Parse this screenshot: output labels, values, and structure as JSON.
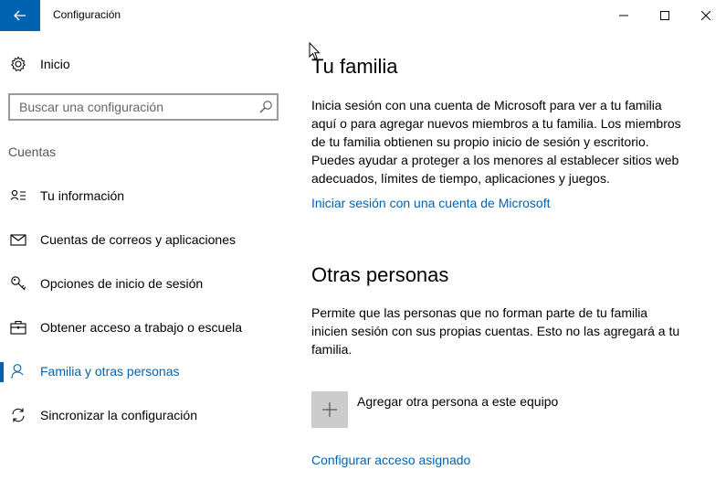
{
  "window": {
    "title": "Configuración",
    "controls": {
      "minimize": "minimize-icon",
      "maximize": "maximize-icon",
      "close": "close-icon"
    }
  },
  "sidebar": {
    "home_label": "Inicio",
    "search_placeholder": "Buscar una configuración",
    "section_title": "Cuentas",
    "items": [
      {
        "label": "Tu información",
        "icon": "user-info-icon",
        "active": false
      },
      {
        "label": "Cuentas de correos y aplicaciones",
        "icon": "mail-icon",
        "active": false
      },
      {
        "label": "Opciones de inicio de sesión",
        "icon": "key-icon",
        "active": false
      },
      {
        "label": "Obtener acceso a trabajo o escuela",
        "icon": "briefcase-icon",
        "active": false
      },
      {
        "label": "Familia y otras personas",
        "icon": "person-icon",
        "active": true
      },
      {
        "label": "Sincronizar la configuración",
        "icon": "sync-icon",
        "active": false
      }
    ]
  },
  "main": {
    "family": {
      "title": "Tu familia",
      "description_lines": [
        "Inicia sesión con una cuenta de Microsoft para ver a tu familia",
        "aquí o para agregar nuevos miembros a tu familia. Los miembros",
        "de tu familia obtienen su propio inicio de sesión y escritorio.",
        "Puedes ayudar a proteger a los menores al establecer sitios web",
        "adecuados, límites de tiempo, aplicaciones y juegos."
      ],
      "signin_link": "Iniciar sesión con una cuenta de Microsoft"
    },
    "others": {
      "title": "Otras personas",
      "description_lines": [
        "Permite que las personas que no forman parte de tu familia",
        "inicien sesión con sus propias cuentas. Esto no las agregará a tu",
        "familia."
      ],
      "add_label": "Agregar otra persona a este equipo",
      "assigned_access_link": "Configurar acceso asignado"
    }
  },
  "colors": {
    "accent": "#0063b1",
    "add_box": "#cccccc"
  }
}
